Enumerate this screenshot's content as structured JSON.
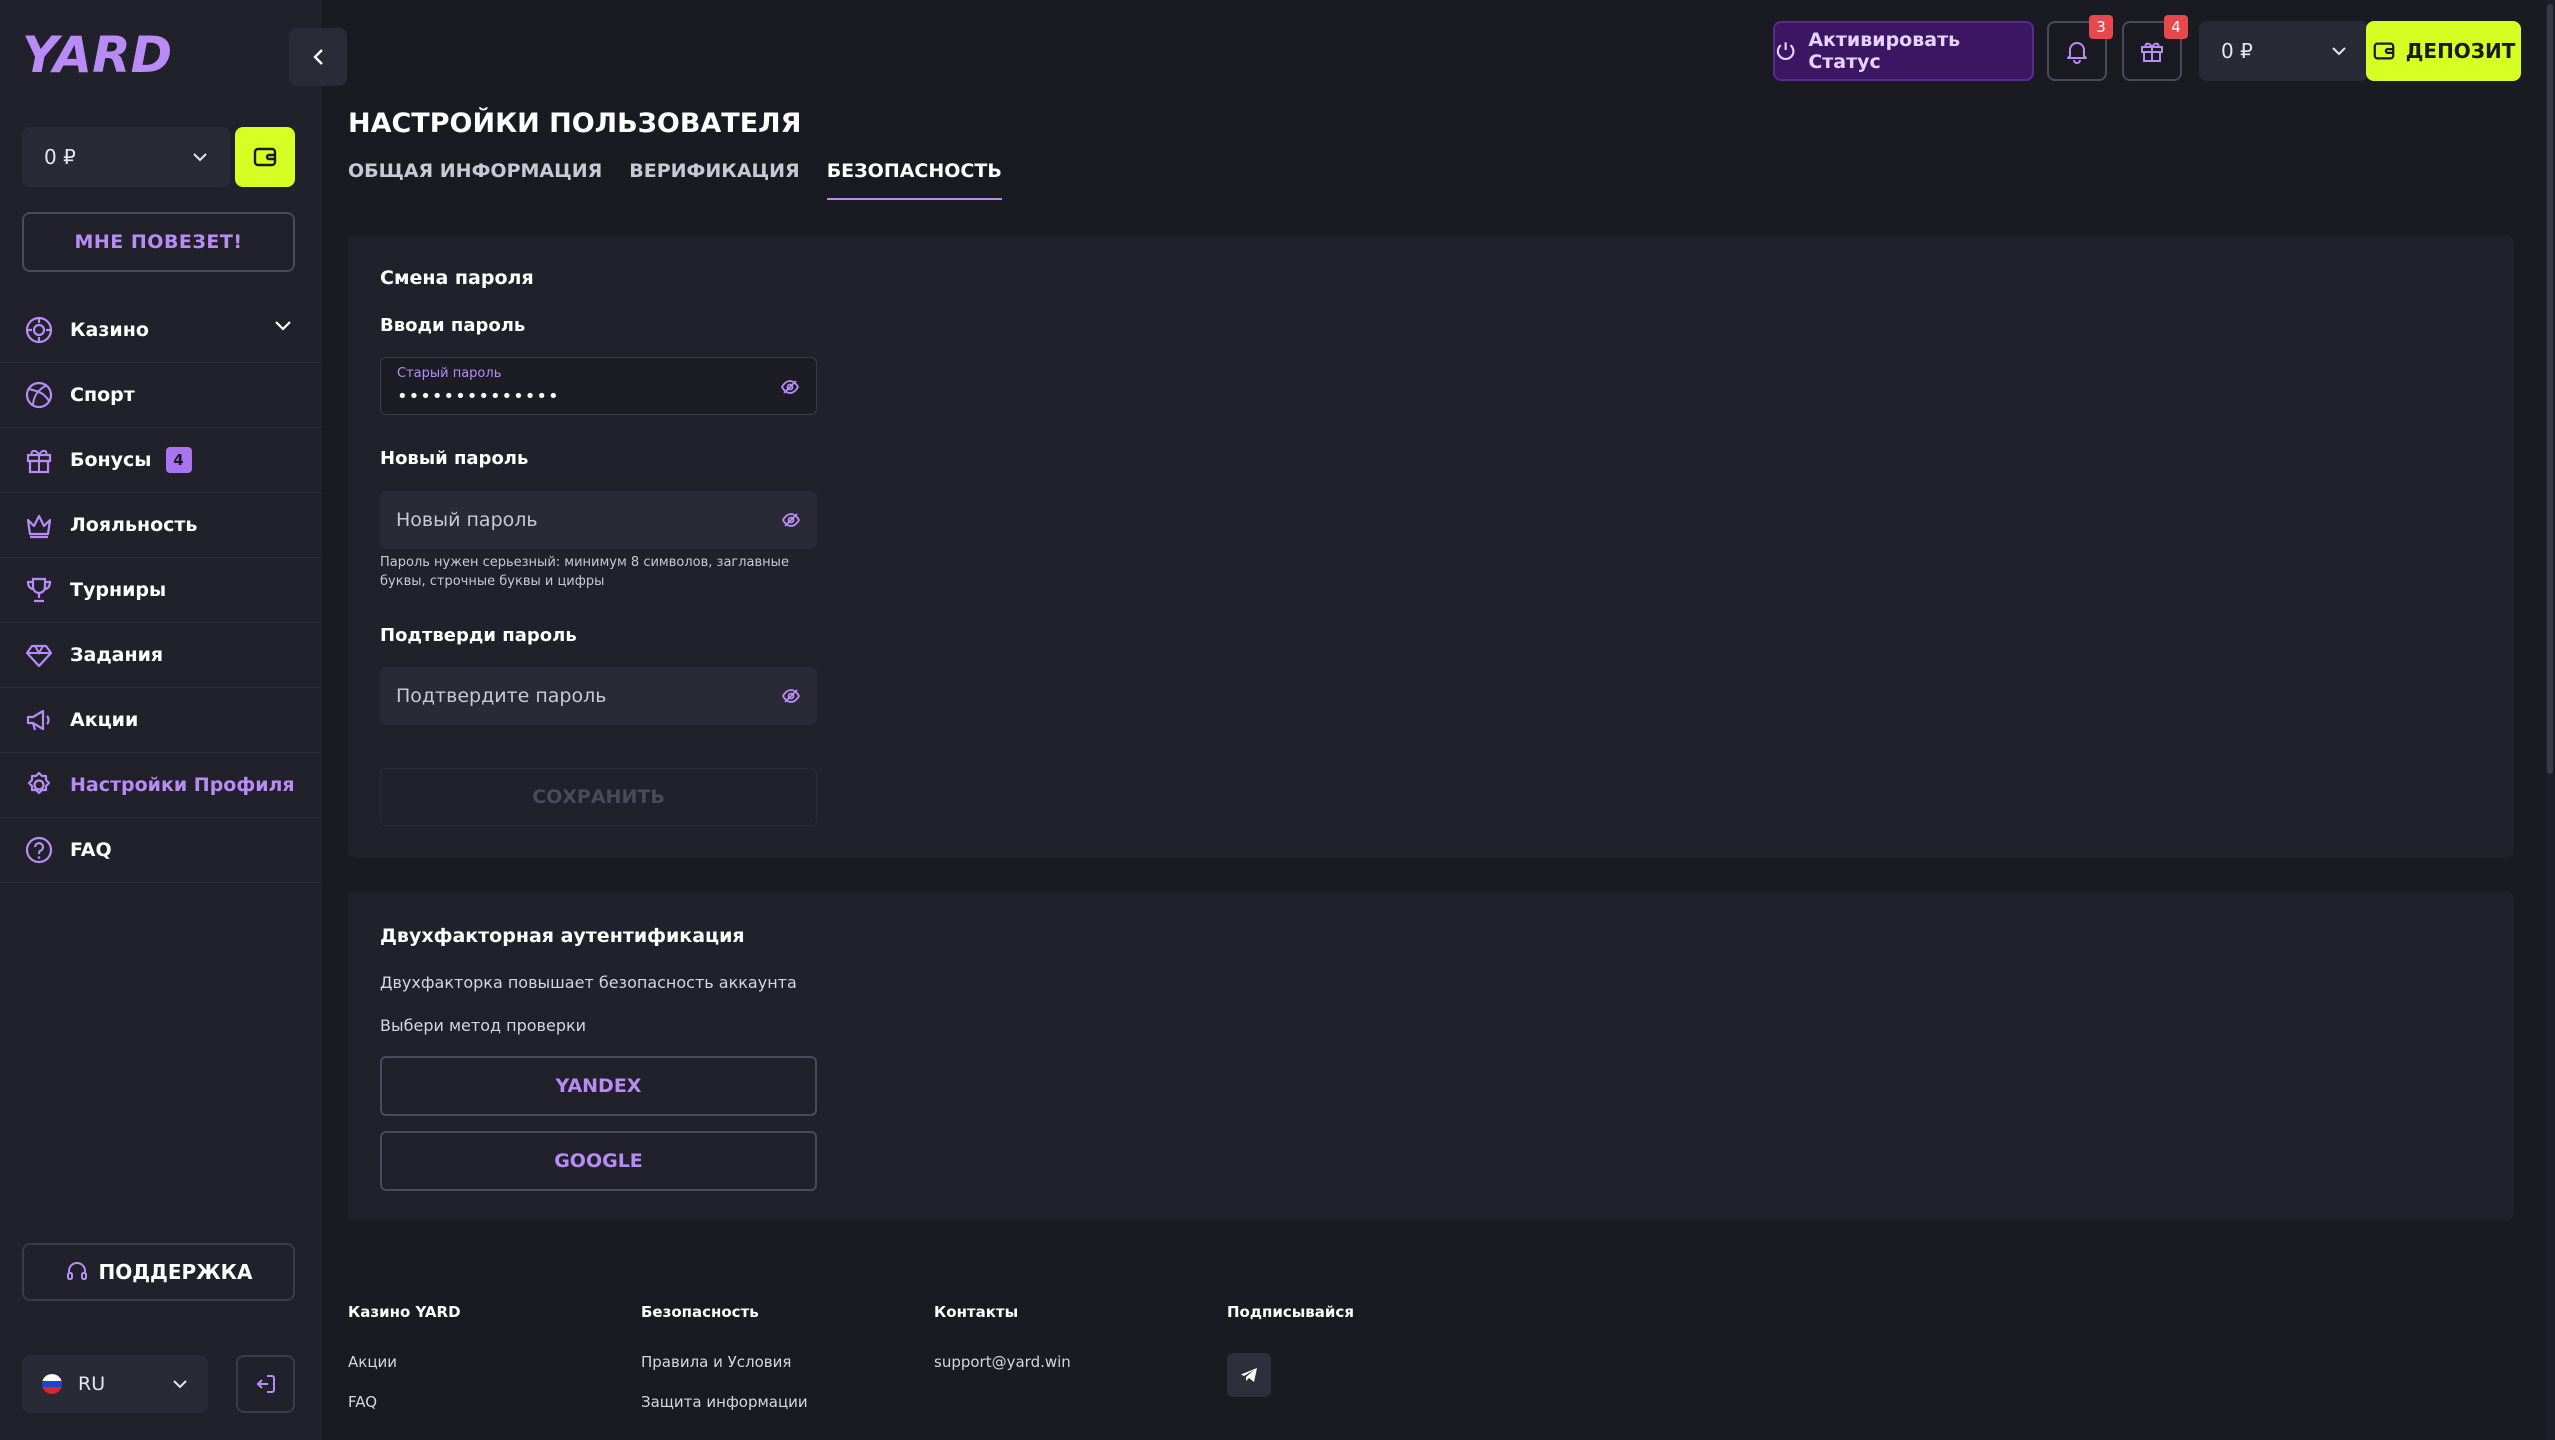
{
  "brand": {
    "logo_text": "YARD"
  },
  "sidebar": {
    "balance": "0 ₽",
    "lucky_label": "МНЕ ПОВЕЗЕТ!",
    "items": [
      {
        "label": "Казино",
        "icon": "casino-chip-icon",
        "has_dropdown": true
      },
      {
        "label": "Спорт",
        "icon": "sports-ball-icon"
      },
      {
        "label": "Бонусы",
        "icon": "gift-icon",
        "badge": "4"
      },
      {
        "label": "Лояльность",
        "icon": "crown-icon"
      },
      {
        "label": "Турниры",
        "icon": "trophy-icon"
      },
      {
        "label": "Задания",
        "icon": "diamond-icon"
      },
      {
        "label": "Акции",
        "icon": "megaphone-icon"
      },
      {
        "label": "Настройки Профиля",
        "icon": "gear-icon",
        "active": true
      },
      {
        "label": "FAQ",
        "icon": "question-icon"
      }
    ],
    "support_label": "ПОДДЕРЖКА",
    "language": "RU"
  },
  "header": {
    "status_label": "Активировать Статус",
    "notifications_count": "3",
    "gifts_count": "4",
    "balance": "0 ₽",
    "deposit_label": "ДЕПОЗИТ"
  },
  "page": {
    "title": "НАСТРОЙКИ ПОЛЬЗОВАТЕЛЯ",
    "tabs": [
      {
        "label": "ОБЩАЯ ИНФОРМАЦИЯ"
      },
      {
        "label": "ВЕРИФИКАЦИЯ"
      },
      {
        "label": "БЕЗОПАСНОСТЬ",
        "active": true
      }
    ]
  },
  "password_section": {
    "heading": "Смена пароля",
    "old_label": "Вводи пароль",
    "old_floating_label": "Старый пароль",
    "old_value": "••••••••••••••",
    "new_label": "Новый пароль",
    "new_placeholder": "Новый пароль",
    "hint": "Пароль нужен серьезный: минимум 8 символов, заглавные буквы, строчные буквы и цифры",
    "confirm_label": "Подтверди пароль",
    "confirm_placeholder": "Подтвердите пароль",
    "save_label": "СОХРАНИТЬ"
  },
  "twofa_section": {
    "heading": "Двухфакторная аутентификация",
    "description": "Двухфакторка повышает безопасность аккаунта",
    "choose_label": "Выбери метод проверки",
    "methods": [
      "YANDEX",
      "GOOGLE"
    ]
  },
  "footer": {
    "columns": [
      {
        "heading": "Казино YARD",
        "links": [
          "Акции",
          "FAQ"
        ]
      },
      {
        "heading": "Безопасность",
        "links": [
          "Правила и Условия",
          "Защита информации"
        ]
      },
      {
        "heading": "Контакты",
        "links": [
          "support@yard.win"
        ]
      },
      {
        "heading": "Подписывайся",
        "links": []
      }
    ]
  },
  "colors": {
    "accent_purple": "#b98cf5",
    "accent_lime": "#d7ff24",
    "badge_red": "#e5484d",
    "background": "#1a1a23",
    "panel": "#21212c"
  }
}
